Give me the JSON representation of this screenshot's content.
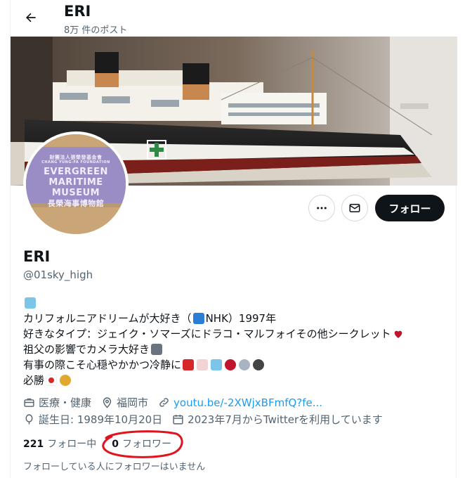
{
  "header": {
    "title": "ERI",
    "post_count": "8万 件のポスト"
  },
  "avatar": {
    "line1": "財團法人張榮發基金會",
    "line2": "CHANG YUNG-FA FOUNDATION",
    "line3": "EVERGREEN",
    "line4": "MARITIME",
    "line5": "MUSEUM",
    "line6": "長榮海事博物館"
  },
  "actions": {
    "follow_label": "フォロー"
  },
  "profile": {
    "name": "ERI",
    "handle": "@01sky_high"
  },
  "bio": {
    "line1": "カリフォルニアドリームが大好き（",
    "line1b": "NHK）1997年",
    "line2": "好きなタイプ：ジェイク・ソマーズにドラコ・マルフォイその他シークレット",
    "line3": "祖父の影響でカメラ大好き",
    "line4": "有事の際こそ心穏やかかつ冷静に",
    "line5": "必勝"
  },
  "meta": {
    "category": "医療・健康",
    "location": "福岡市",
    "link": "youtu.be/-2XWjxBFmfQ?fe...",
    "birthday": "誕生日: 1989年10月20日",
    "joined": "2023年7月からTwitterを利用しています"
  },
  "stats": {
    "following_count": "221",
    "following_label": "フォロー中",
    "followers_count": "0",
    "followers_label": "フォロワー"
  },
  "note": "フォローしている人にフォロワーはいません",
  "colors": {
    "accent": "#1d9bf0",
    "text": "#0f1419",
    "secondary": "#536471",
    "annotation": "#e0141e"
  }
}
